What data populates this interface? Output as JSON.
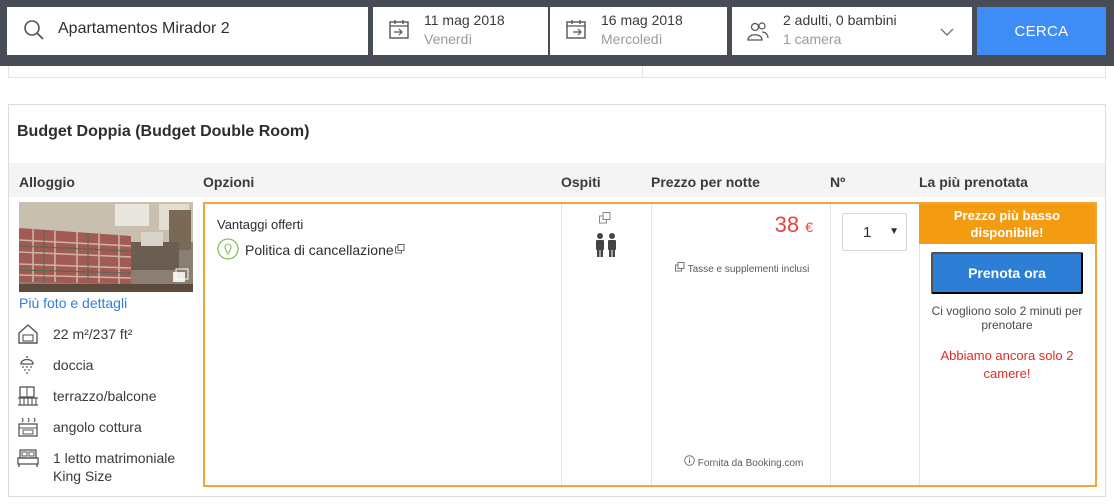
{
  "search": {
    "destination": "Apartamentos Mirador 2",
    "checkin": {
      "date": "11 mag 2018",
      "weekday": "Venerdì"
    },
    "checkout": {
      "date": "16 mag 2018",
      "weekday": "Mercoledì"
    },
    "guests": {
      "summary": "2 adulti, 0 bambini",
      "rooms": "1 camera"
    },
    "button_label": "CERCA"
  },
  "room": {
    "title": "Budget Doppia (Budget Double Room)",
    "more_photos_label": "Più foto e dettagli",
    "amenities": [
      {
        "icon": "area-icon",
        "label": "22 m²/237 ft²"
      },
      {
        "icon": "shower-icon",
        "label": "doccia"
      },
      {
        "icon": "balcony-icon",
        "label": "terrazzo/balcone"
      },
      {
        "icon": "kitchenette-icon",
        "label": "angolo cottura"
      },
      {
        "icon": "bed-icon",
        "label": "1 letto matrimoniale King Size"
      }
    ]
  },
  "columns": {
    "alloggio": "Alloggio",
    "opzioni": "Opzioni",
    "ospiti": "Ospiti",
    "prezzo": "Prezzo per notte",
    "numero": "Nº",
    "prenotata": "La più prenotata"
  },
  "offer": {
    "benefits_title": "Vantaggi offerti",
    "cancellation_label": "Politica di cancellazione",
    "price": "38",
    "currency": "€",
    "taxes_note": "Tasse e supplementi inclusi",
    "provider_note": "Fornita da Booking.com",
    "quantity": "1",
    "badge": "Prezzo più basso disponibile!",
    "book_label": "Prenota ora",
    "hint": "Ci vogliono solo 2 minuti per prenotare",
    "scarcity": "Abbiamo ancora solo 2 camere!"
  },
  "colors": {
    "header_bg": "#474c57",
    "search_button": "#3e8cf6",
    "book_button": "#2d7fd5",
    "badge": "#f39c12",
    "price": "#e8453c",
    "scarcity": "#e02b27"
  }
}
